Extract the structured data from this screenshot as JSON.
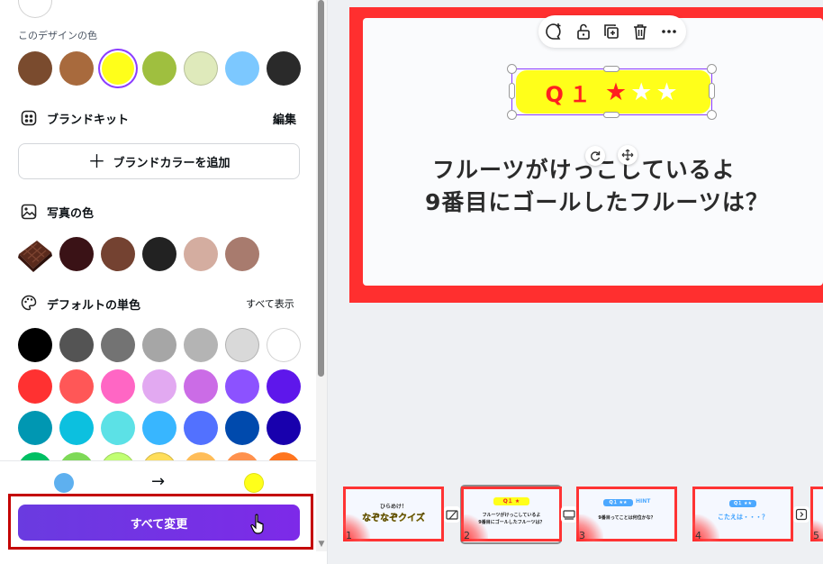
{
  "panel": {
    "design_colors_label": "このデザインの色",
    "design_colors": [
      "#7a4b2e",
      "#a86a3d",
      "#ffff1a",
      "#9fbf3f",
      "#dfeabb",
      "#7cc8ff",
      "#2a2a2a"
    ],
    "brand_kit": {
      "title": "ブランドキット",
      "edit_label": "編集",
      "add_button_label": "ブランドカラーを追加"
    },
    "photo_colors": {
      "title": "写真の色",
      "colors": [
        "#3a1216",
        "#744231",
        "#222222",
        "#d4ada0",
        "#a87b6e"
      ]
    },
    "default_colors": {
      "title": "デフォルトの単色",
      "show_all_label": "すべて表示",
      "rows": [
        [
          "#000000",
          "#545454",
          "#737373",
          "#a6a6a6",
          "#b4b4b4",
          "#d9d9d9",
          "#ffffff"
        ],
        [
          "#ff3131",
          "#ff5757",
          "#ff66c4",
          "#e2a9f1",
          "#cb6ce6",
          "#8c52ff",
          "#5e17eb"
        ],
        [
          "#0097b2",
          "#0cc0df",
          "#5ce1e6",
          "#38b6ff",
          "#5271ff",
          "#004aad",
          "#1800ad"
        ],
        [
          "#00bf63",
          "#7ed957",
          "#c1ff72",
          "#ffde59",
          "#ffbd59",
          "#ff914d",
          "#ff751f"
        ]
      ]
    },
    "replace": {
      "from_color": "#5eb0ef",
      "arrow": "→",
      "to_color": "#ffff1a"
    },
    "change_all_label": "すべて変更"
  },
  "slide": {
    "badge_text": "Q１",
    "line1": "フルーツがけっこしているよ",
    "line2": "9番目にゴールしたフルーツは？"
  },
  "thumbnails": [
    {
      "number": "1",
      "caption": "ひらめけ！",
      "title": "なぞなぞクイズ"
    },
    {
      "number": "2",
      "badge": "Q１ ★",
      "line1": "フルーツがけっこしているよ",
      "line2": "9番目にゴールしたフルーツは？"
    },
    {
      "number": "3",
      "badge": "Q１ ★★",
      "hint": "HINT",
      "line1": "9番目ってことは何位かな？"
    },
    {
      "number": "4",
      "badge": "Q１ ★★",
      "line1": "こたえは・・・？"
    },
    {
      "number": "5"
    }
  ]
}
